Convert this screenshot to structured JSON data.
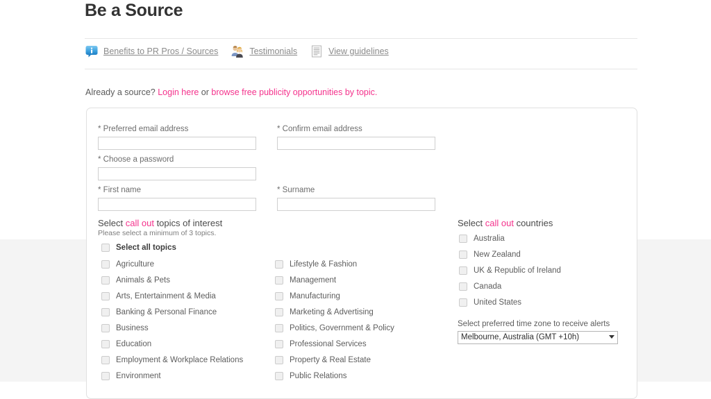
{
  "page": {
    "title": "Be a Source",
    "accent_color": "#f4328c",
    "background_upper": "#ffffff",
    "background_lower": "#f4f4f4"
  },
  "nav": {
    "items": [
      {
        "label": "Benefits to PR Pros / Sources",
        "icon": "info-bubble-icon"
      },
      {
        "label": "Testimonials",
        "icon": "people-icon"
      },
      {
        "label": "View guidelines",
        "icon": "document-icon"
      }
    ]
  },
  "login_prompt": {
    "prefix": "Already a source? ",
    "login_link": "Login here",
    "middle": " or ",
    "browse_link": "browse free publicity opportunities by topic",
    "suffix": "."
  },
  "form": {
    "fields": [
      {
        "label": "* Preferred email address",
        "value": "",
        "placeholder": "",
        "name": "preferred-email"
      },
      {
        "label": "* Confirm email address",
        "value": "",
        "placeholder": "",
        "name": "confirm-email"
      },
      {
        "label": "* Choose a password",
        "value": "",
        "placeholder": "",
        "name": "password"
      },
      {
        "label": "* First name",
        "value": "",
        "placeholder": "",
        "name": "first-name"
      },
      {
        "label": "* Surname",
        "value": "",
        "placeholder": "",
        "name": "surname"
      }
    ]
  },
  "topics": {
    "heading_prefix": "Select ",
    "heading_accent": "call out",
    "heading_suffix": " topics of interest",
    "subtext": "Please select a minimum of 3 topics.",
    "select_all_label": "Select all topics",
    "select_all_checked": false,
    "column_left": [
      {
        "label": "Agriculture",
        "checked": false
      },
      {
        "label": "Animals & Pets",
        "checked": false
      },
      {
        "label": "Arts, Entertainment & Media",
        "checked": false
      },
      {
        "label": "Banking & Personal Finance",
        "checked": false
      },
      {
        "label": "Business",
        "checked": false
      },
      {
        "label": "Education",
        "checked": false
      },
      {
        "label": "Employment & Workplace Relations",
        "checked": false
      },
      {
        "label": "Environment",
        "checked": false
      }
    ],
    "column_right": [
      {
        "label": "Lifestyle & Fashion",
        "checked": false
      },
      {
        "label": "Management",
        "checked": false
      },
      {
        "label": "Manufacturing",
        "checked": false
      },
      {
        "label": "Marketing & Advertising",
        "checked": false
      },
      {
        "label": "Politics, Government & Policy",
        "checked": false
      },
      {
        "label": "Professional Services",
        "checked": false
      },
      {
        "label": "Property & Real Estate",
        "checked": false
      },
      {
        "label": "Public Relations",
        "checked": false
      }
    ]
  },
  "countries": {
    "heading_prefix": "Select ",
    "heading_accent": "call out",
    "heading_suffix": " countries",
    "items": [
      {
        "label": "Australia",
        "checked": false
      },
      {
        "label": "New Zealand",
        "checked": false
      },
      {
        "label": "UK & Republic of Ireland",
        "checked": false
      },
      {
        "label": "Canada",
        "checked": false
      },
      {
        "label": "United States",
        "checked": false
      }
    ]
  },
  "timezone": {
    "label": "Select preferred time zone to receive alerts",
    "selected": "Melbourne, Australia (GMT +10h)"
  }
}
